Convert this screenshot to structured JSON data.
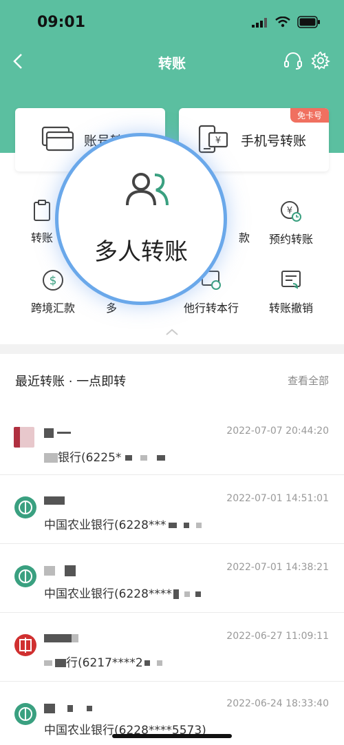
{
  "status_bar": {
    "time": "09:01"
  },
  "nav": {
    "title": "转账"
  },
  "cards": [
    {
      "label": "账号转账",
      "icon": "card-icon"
    },
    {
      "label": "手机号转账",
      "icon": "phone-yen-icon",
      "badge": "免卡号"
    }
  ],
  "grid": [
    {
      "label": "转账",
      "icon": "clipboard-icon"
    },
    {
      "label": "款",
      "icon": "transfer-icon"
    },
    {
      "label": "预约转账",
      "icon": "yen-clock-icon"
    },
    {
      "label": "跨境汇款",
      "icon": "dollar-icon"
    },
    {
      "label": "多",
      "icon": "group-icon"
    },
    {
      "label": "他行转本行",
      "icon": "bank-transfer-icon"
    },
    {
      "label": "转账撤销",
      "icon": "revoke-icon"
    }
  ],
  "magnifier": {
    "label": "多人转账",
    "icon": "multi-person-icon"
  },
  "recent": {
    "title": "最近转账 · 一点即转",
    "view_all": "查看全部",
    "rows": [
      {
        "time": "2022-07-07 20:44:20",
        "acct": "银行(6225*",
        "icon": "bank-logo-icon",
        "color": "#b03040"
      },
      {
        "time": "2022-07-01 14:51:01",
        "acct": "中国农业银行(6228***",
        "icon": "abc-bank-icon",
        "color": "#3aa080"
      },
      {
        "time": "2022-07-01 14:38:21",
        "acct": "中国农业银行(6228****",
        "icon": "abc-bank-icon",
        "color": "#3aa080"
      },
      {
        "time": "2022-06-27 11:09:11",
        "acct": "行(6217****2",
        "icon": "citic-bank-icon",
        "color": "#d03030"
      },
      {
        "time": "2022-06-24 18:33:40",
        "acct": "中国农业银行(6228****5573)",
        "icon": "abc-bank-icon",
        "color": "#3aa080"
      }
    ]
  }
}
